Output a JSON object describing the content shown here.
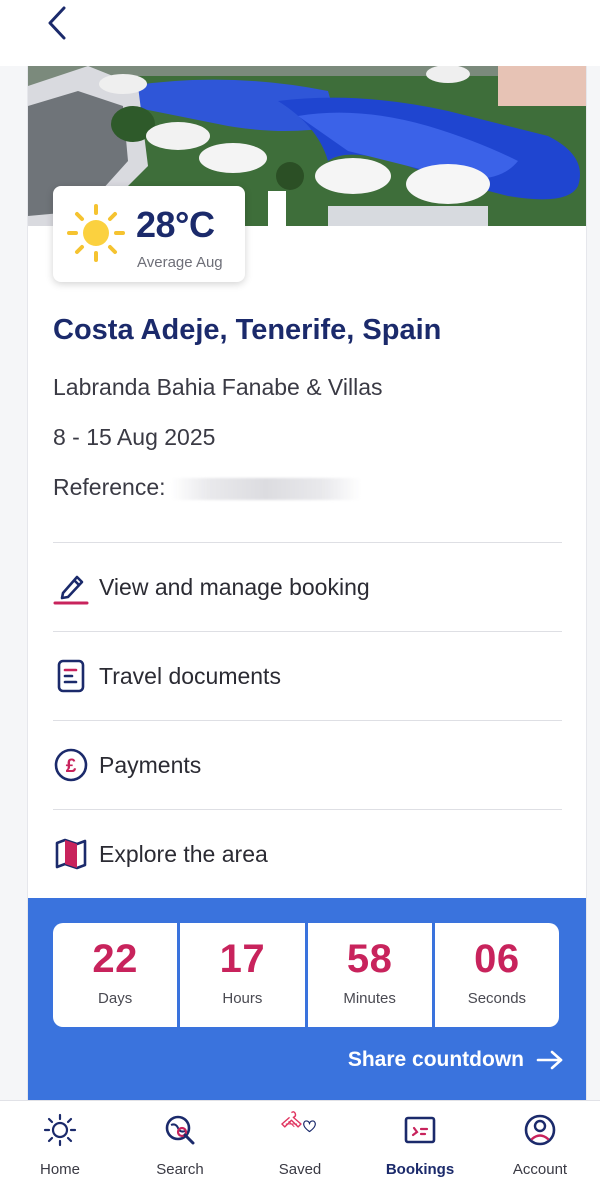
{
  "weather": {
    "temperature": "28°C",
    "label": "Average Aug",
    "icon": "sun-icon"
  },
  "booking": {
    "destination": "Costa Adeje, Tenerife, Spain",
    "hotel": "Labranda Bahia Fanabe & Villas",
    "dates": "8 - 15 Aug 2025",
    "reference_label": "Reference:"
  },
  "menu": [
    {
      "label": "View and manage booking",
      "icon": "pencil-icon"
    },
    {
      "label": "Travel documents",
      "icon": "document-icon"
    },
    {
      "label": "Payments",
      "icon": "pound-coin-icon"
    },
    {
      "label": "Explore the area",
      "icon": "map-icon"
    }
  ],
  "countdown": {
    "units": [
      {
        "value": "22",
        "label": "Days"
      },
      {
        "value": "17",
        "label": "Hours"
      },
      {
        "value": "58",
        "label": "Minutes"
      },
      {
        "value": "06",
        "label": "Seconds"
      }
    ],
    "share_label": "Share countdown"
  },
  "tabs": [
    {
      "label": "Home",
      "icon": "sun-outline-icon",
      "active": false
    },
    {
      "label": "Search",
      "icon": "search-globe-icon",
      "active": false
    },
    {
      "label": "Saved",
      "icon": "heart-icon",
      "active": false
    },
    {
      "label": "Bookings",
      "icon": "ticket-icon",
      "active": true
    },
    {
      "label": "Account",
      "icon": "account-icon",
      "active": false
    }
  ],
  "colors": {
    "navy": "#1b2a6b",
    "accent_pink": "#c8235c",
    "countdown_blue": "#3a73dd"
  }
}
